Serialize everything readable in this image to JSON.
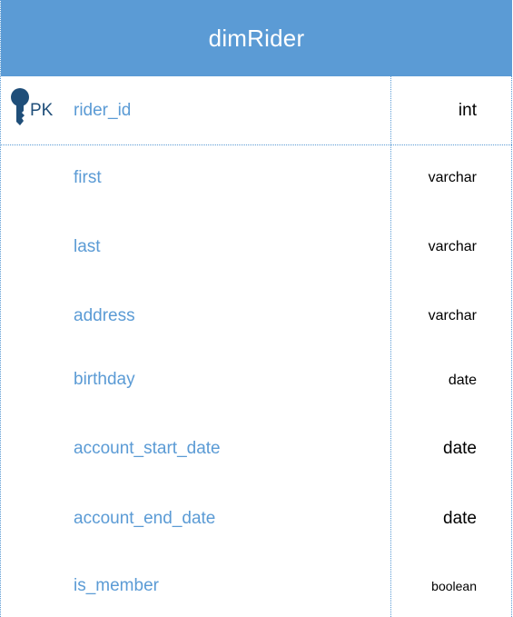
{
  "table": {
    "name": "dimRider",
    "primary_key_label": "PK",
    "columns": [
      {
        "name": "rider_id",
        "type": "int",
        "primary_key": true
      },
      {
        "name": "first",
        "type": "varchar"
      },
      {
        "name": "last",
        "type": "varchar"
      },
      {
        "name": "address",
        "type": "varchar"
      },
      {
        "name": "birthday",
        "type": "date"
      },
      {
        "name": "account_start_date",
        "type": "date"
      },
      {
        "name": "account_end_date",
        "type": "date"
      },
      {
        "name": "is_member",
        "type": "boolean"
      }
    ]
  },
  "colors": {
    "header": "#5b9bd5",
    "field_name": "#5b9bd5",
    "key_icon": "#1f4e79"
  }
}
